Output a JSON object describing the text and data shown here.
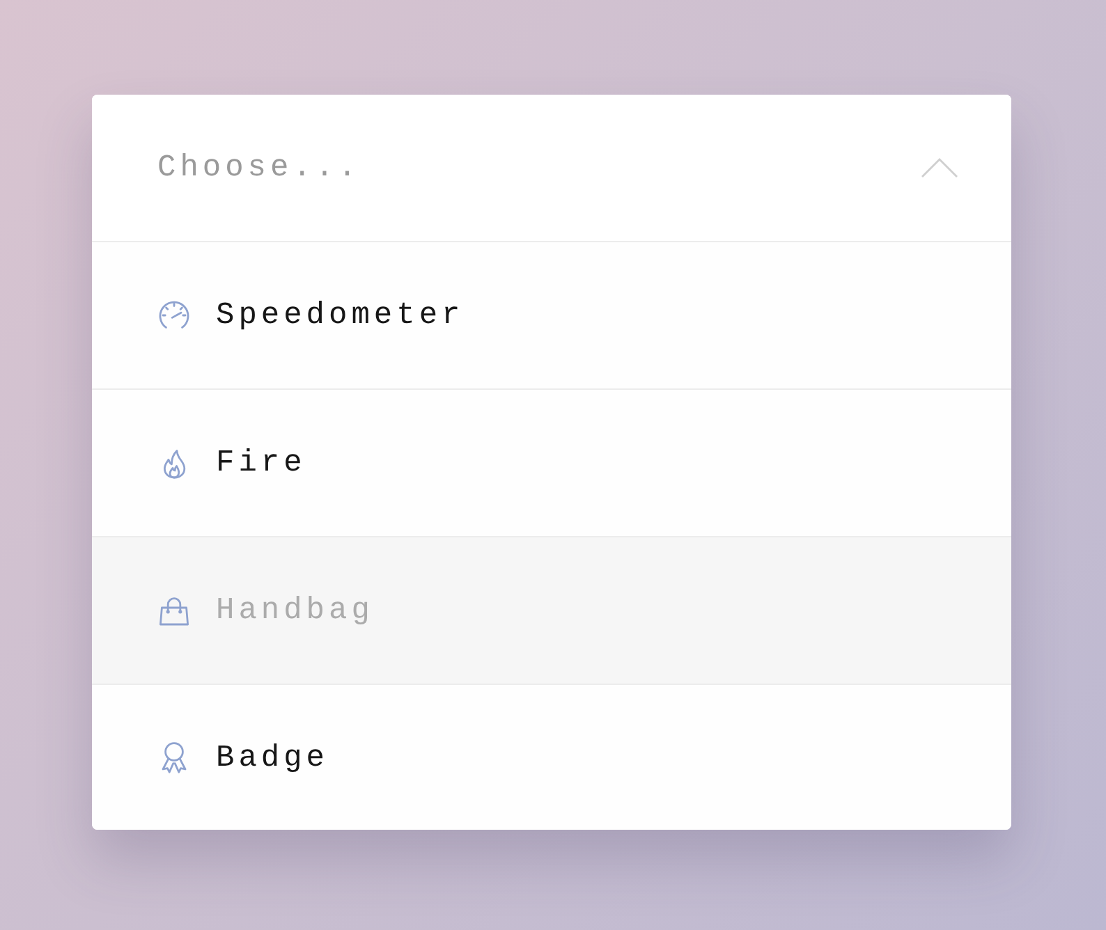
{
  "select": {
    "placeholder": "Choose...",
    "expanded": true
  },
  "options": [
    {
      "label": "Speedometer",
      "disabled": false
    },
    {
      "label": "Fire",
      "disabled": false
    },
    {
      "label": "Handbag",
      "disabled": true
    },
    {
      "label": "Badge",
      "disabled": false
    }
  ]
}
